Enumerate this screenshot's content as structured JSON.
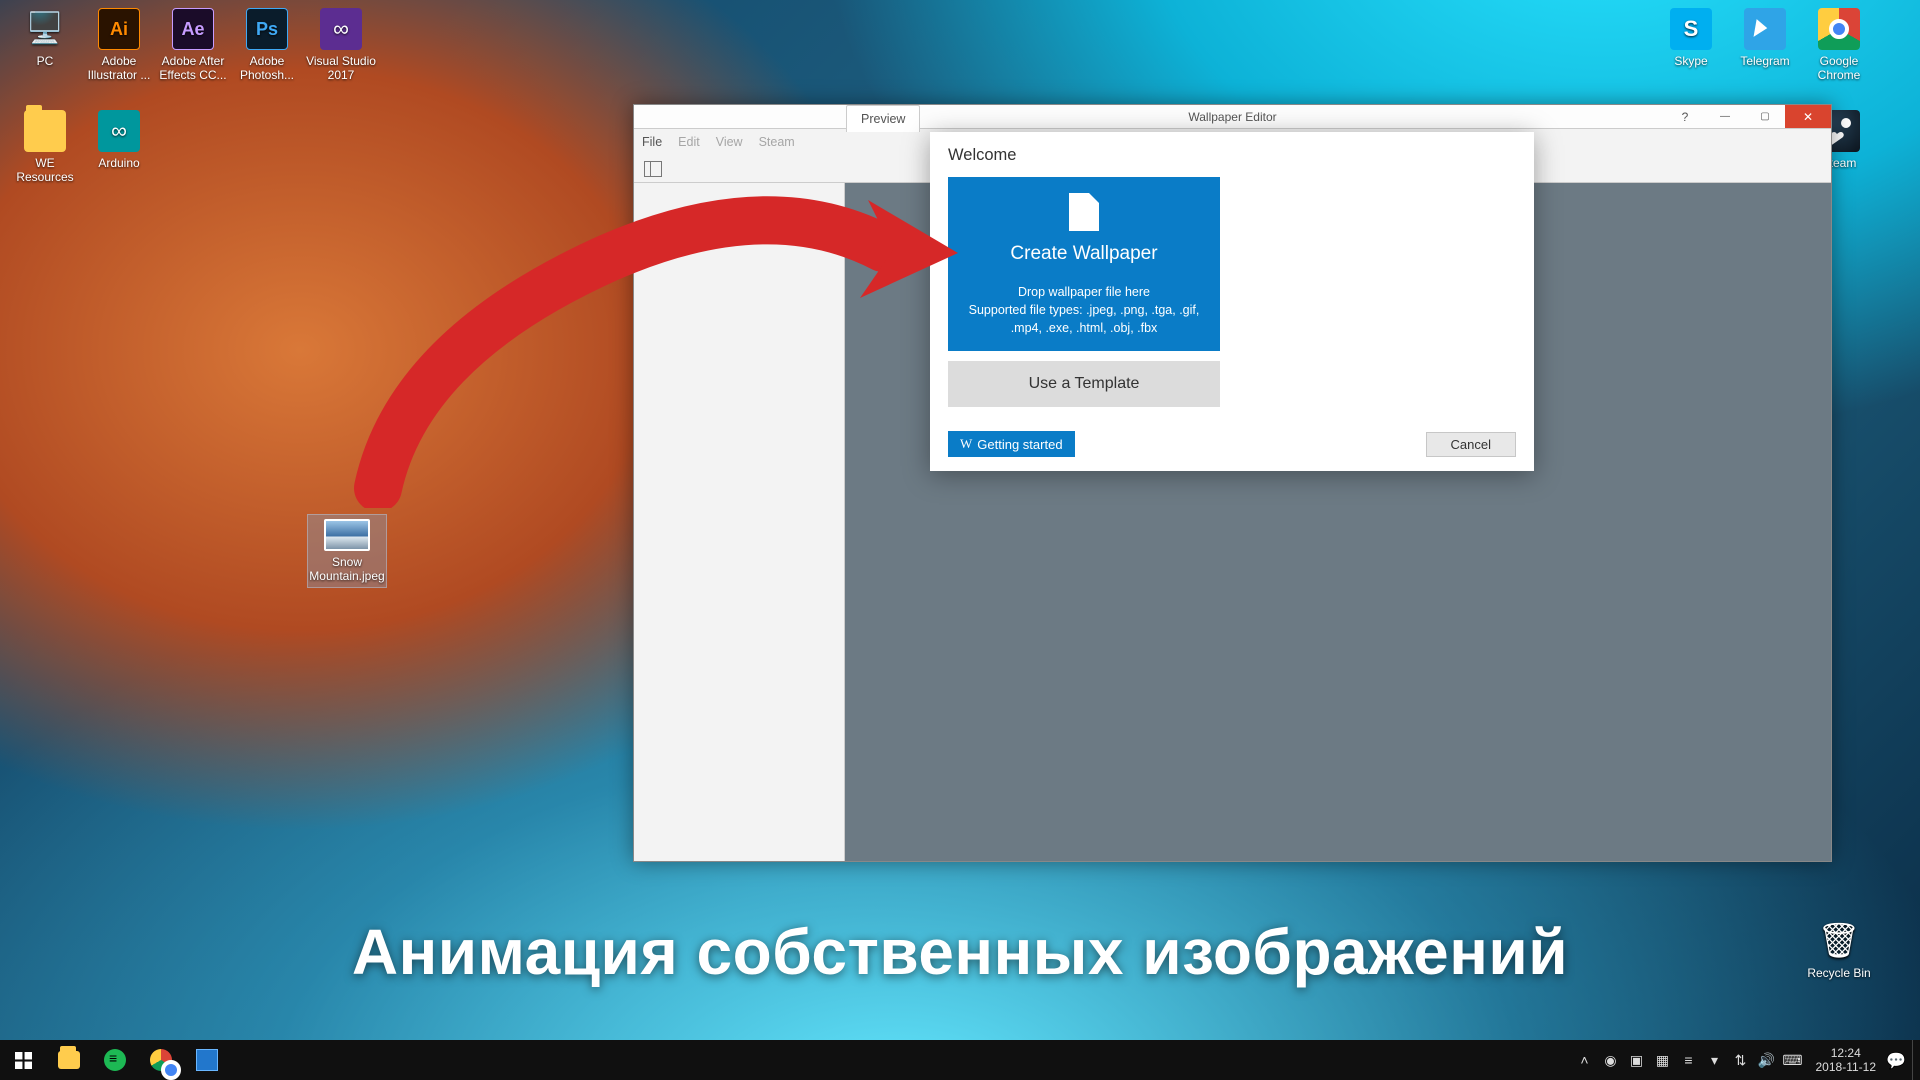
{
  "desktop_icons_left": [
    {
      "label": "PC"
    },
    {
      "label": "Adobe Illustrator ..."
    },
    {
      "label": "Adobe After Effects CC..."
    },
    {
      "label": "Adobe Photosh..."
    },
    {
      "label": "Visual Studio 2017"
    },
    {
      "label": "WE Resources"
    },
    {
      "label": "Arduino"
    }
  ],
  "desktop_icons_right": [
    {
      "label": "Skype"
    },
    {
      "label": "Telegram"
    },
    {
      "label": "Google Chrome"
    },
    {
      "label": "Steam"
    },
    {
      "label": "Recycle Bin"
    }
  ],
  "selected_file": {
    "label": "Snow Mountain.jpeg"
  },
  "editor": {
    "title": "Wallpaper Editor",
    "menu": {
      "file": "File",
      "edit": "Edit",
      "view": "View",
      "steam": "Steam"
    },
    "tab_preview": "Preview"
  },
  "dialog": {
    "title": "Welcome",
    "create": {
      "title": "Create Wallpaper",
      "drop": "Drop wallpaper file here",
      "supported": "Supported file types: .jpeg, .png, .tga, .gif, .mp4, .exe, .html, .obj, .fbx"
    },
    "template_label": "Use a Template",
    "getting_started": "Getting started",
    "cancel": "Cancel"
  },
  "caption": "Анимация собственных изображений",
  "clock": {
    "time": "12:24",
    "date": "2018-11-12"
  }
}
